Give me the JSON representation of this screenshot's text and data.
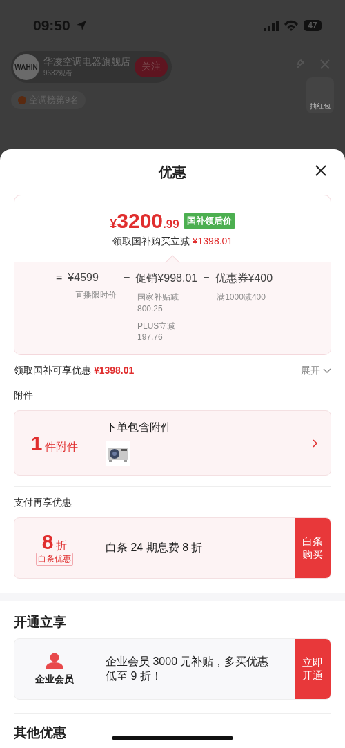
{
  "status_bar": {
    "time": "09:50",
    "battery": "47"
  },
  "live": {
    "logo_text": "WAHIN",
    "store_name": "华凌空调电器旗舰店",
    "viewers": "9632观看",
    "follow_button": "关注",
    "rank_tag": "空调榜第9名",
    "side_badge": "抽红包"
  },
  "sheet": {
    "title": "优惠"
  },
  "price_card": {
    "currency": "¥",
    "price_int": "3200",
    "price_dec": ".99",
    "price_tag": "国补领后价",
    "saving_label": "领取国补购买立减",
    "saving_amount": "¥1398.01",
    "breakdown": [
      {
        "operator": "=",
        "amount": "¥4599",
        "notes": [
          "直播限时价"
        ]
      },
      {
        "operator": "−",
        "amount": "促销¥998.01",
        "notes": [
          "国家补贴减800.25",
          "PLUS立减197.76"
        ]
      },
      {
        "operator": "−",
        "amount": "优惠券¥400",
        "notes": [
          "满1000减400"
        ]
      }
    ]
  },
  "summary": {
    "label": "领取国补可享优惠",
    "amount": "¥1398.01",
    "toggle": "展开",
    "expanded": false
  },
  "accessories": {
    "heading": "附件",
    "count": "1",
    "unit": "件附件",
    "title": "下单包含附件"
  },
  "payment": {
    "heading": "支付再享优惠",
    "discount": "8",
    "unit": "折",
    "tag": "白条优惠",
    "description": "白条 24 期息费 8 折",
    "button": "白条购买"
  },
  "membership": {
    "heading": "开通立享",
    "name": "企业会员",
    "description": "企业会员 3000 元补贴，多买优惠低至 9 折！",
    "button": "立即开通"
  },
  "other": {
    "heading": "其他优惠"
  }
}
